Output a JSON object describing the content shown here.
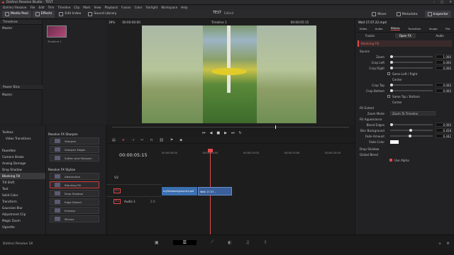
{
  "app": {
    "title": "DaVinci Resolve Studio - TEST",
    "version": "DaVinci Resolve 18"
  },
  "menu": [
    "DaVinci Resolve",
    "File",
    "Edit",
    "Trim",
    "Timeline",
    "Clip",
    "Mark",
    "View",
    "Playback",
    "Fusion",
    "Color",
    "Fairlight",
    "Workspace",
    "Help"
  ],
  "toolbar": {
    "media_pool": "Media Pool",
    "effects": "Effects",
    "edit_index": "Edit Index",
    "sound_library": "Sound Library",
    "project": "TEST",
    "project_status": "Edited",
    "mixer": "Mixer",
    "metadata": "Metadata",
    "inspector": "Inspector"
  },
  "bins": {
    "header": "Timelines",
    "master": "Master",
    "power_bins": "Power Bins",
    "power_master": "Master"
  },
  "media": {
    "clip_name": "Timeline 1"
  },
  "viewer": {
    "zoom": "39%",
    "src_tc": "00:00:00:00",
    "timeline_name": "Timeline 1",
    "tc": "00:00:05:15"
  },
  "effects_tree": {
    "toolbox": "Toolbox",
    "video_transitions": "Video Transitions",
    "favorites_header": "Favorites",
    "favorites": [
      "Camera Shake",
      "Analog Damage",
      "Drop Shadow",
      "Blanking Fill",
      "Tilt Shift",
      "Text",
      "Solid Color",
      "Transform",
      "Gaussian Blur",
      "Adjustment Clip",
      "Magic Zoom",
      "Vignette"
    ]
  },
  "effects_lists": {
    "sharpen_header": "Resolve FX Sharpen",
    "sharpen": [
      "Sharpen",
      "Sharpen Edges",
      "Soften and Sharpen"
    ],
    "stylize_header": "Resolve FX Stylize",
    "stylize": [
      "Abstraction",
      "Blanking Fill",
      "Drop Shadow",
      "Edge Detect",
      "Emboss",
      "Mirrors"
    ]
  },
  "timeline": {
    "tc": "00:00:05:15",
    "ruler": [
      "00:00:00:00",
      "00:00:05:00",
      "00:00:10:00",
      "00:00:15:00",
      "00:00:20:00"
    ],
    "v2": "V2",
    "v1": "V1",
    "a1": "A1",
    "a1_name": "Audio 1",
    "a1_vol": "2.0",
    "clip1": "myfreebackground.mp4",
    "clip2": "Wait 17.07..."
  },
  "inspector": {
    "clip": "Wait 17.07.22.mp4",
    "tabs": [
      "Video",
      "Audio",
      "Effects",
      "Transition",
      "Image",
      "File"
    ],
    "subtabs": [
      "Fusion",
      "Open FX",
      "Audio"
    ],
    "effect": "Blanking Fill",
    "source_title": "Source",
    "params": [
      {
        "label": "Zoom",
        "value": "1.000"
      },
      {
        "label": "Crop Left",
        "value": "0.000"
      },
      {
        "label": "Crop Right",
        "value": "0.000"
      }
    ],
    "same_lr": "Same Left / Right",
    "center1": "Center",
    "params2": [
      {
        "label": "Crop Top",
        "value": "0.000"
      },
      {
        "label": "Crop Bottom",
        "value": "0.000"
      }
    ],
    "same_tb": "Same Top / Bottom",
    "center2": "Center",
    "fill_extent": "Fill Extent",
    "zoom_mode_label": "Zoom Mode",
    "zoom_mode": "Zoom To Timeline",
    "fill_appearance": "Fill Appearance",
    "params3": [
      {
        "label": "Blend Edges",
        "value": "0.000"
      },
      {
        "label": "Blur Background",
        "value": "0.458"
      },
      {
        "label": "Fade Amount",
        "value": "0.442"
      }
    ],
    "fade_color": "Fade Color",
    "drop_shadow": "Drop Shadow",
    "global_blend": "Global Blend",
    "use_alpha": "Use Alpha"
  },
  "colors": {
    "accent": "#d84545",
    "clip_blue": "#3b6fb0"
  }
}
